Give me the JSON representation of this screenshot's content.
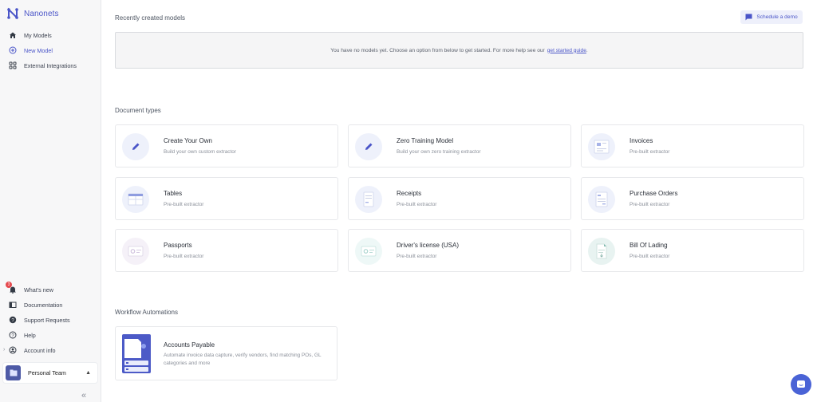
{
  "sidebar": {
    "brand": "Nanonets",
    "nav": [
      {
        "label": "My Models",
        "icon": "home-icon"
      },
      {
        "label": "New Model",
        "icon": "plus-circle-icon"
      },
      {
        "label": "External Integrations",
        "icon": "grid-icon"
      }
    ],
    "bottom": [
      {
        "label": "What's new",
        "icon": "bell-icon",
        "badge": "3"
      },
      {
        "label": "Documentation",
        "icon": "book-icon"
      },
      {
        "label": "Support Requests",
        "icon": "question-icon"
      },
      {
        "label": "Help",
        "icon": "help-icon"
      },
      {
        "label": "Account info",
        "icon": "user-circle-icon"
      }
    ],
    "team": "Personal Team",
    "collapse": "«"
  },
  "header": {
    "recent_title": "Recently created models",
    "schedule_demo": "Schedule a demo"
  },
  "empty_state": {
    "text": "You have no models yet. Choose an option from below to get started. For more help see our",
    "link": "get started guide",
    "suffix": "."
  },
  "document_types": {
    "title": "Document types",
    "cards": [
      {
        "title": "Create Your Own",
        "sub": "Build your own custom extractor",
        "icon": "pencil-icon"
      },
      {
        "title": "Zero Training Model",
        "sub": "Build your own zero training extractor",
        "icon": "pencil-icon"
      },
      {
        "title": "Invoices",
        "sub": "Pre-built extractor",
        "icon": "invoice-icon"
      },
      {
        "title": "Tables",
        "sub": "Pre-built extractor",
        "icon": "table-icon"
      },
      {
        "title": "Receipts",
        "sub": "Pre-built extractor",
        "icon": "receipt-icon"
      },
      {
        "title": "Purchase Orders",
        "sub": "Pre-built extractor",
        "icon": "purchase-order-icon"
      },
      {
        "title": "Passports",
        "sub": "Pre-built extractor",
        "icon": "passport-icon"
      },
      {
        "title": "Driver's license (USA)",
        "sub": "Pre-built extractor",
        "icon": "license-icon"
      },
      {
        "title": "Bill Of Lading",
        "sub": "Pre-built extractor",
        "icon": "bill-of-lading-icon"
      }
    ]
  },
  "workflows": {
    "title": "Workflow Automations",
    "card": {
      "title": "Accounts Payable",
      "desc": "Automate invoice data capture, verify vendors, find matching POs, GL categories and more"
    }
  },
  "colors": {
    "accent": "#4a55c8",
    "sidebar_bg": "#f7f7f8",
    "card_border": "#e7e8eb"
  }
}
